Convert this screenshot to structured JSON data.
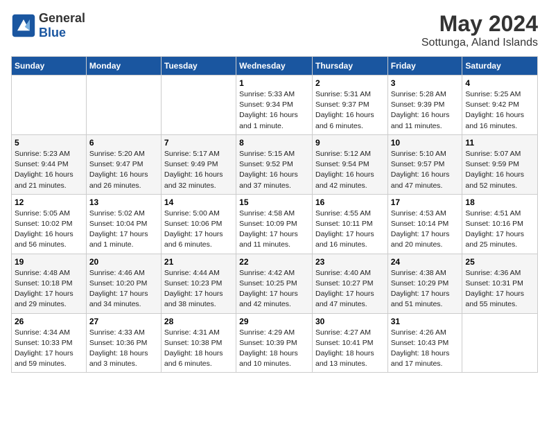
{
  "header": {
    "logo_general": "General",
    "logo_blue": "Blue",
    "month_year": "May 2024",
    "location": "Sottunga, Aland Islands"
  },
  "weekdays": [
    "Sunday",
    "Monday",
    "Tuesday",
    "Wednesday",
    "Thursday",
    "Friday",
    "Saturday"
  ],
  "weeks": [
    [
      {
        "day": "",
        "info": ""
      },
      {
        "day": "",
        "info": ""
      },
      {
        "day": "",
        "info": ""
      },
      {
        "day": "1",
        "info": "Sunrise: 5:33 AM\nSunset: 9:34 PM\nDaylight: 16 hours and 1 minute."
      },
      {
        "day": "2",
        "info": "Sunrise: 5:31 AM\nSunset: 9:37 PM\nDaylight: 16 hours and 6 minutes."
      },
      {
        "day": "3",
        "info": "Sunrise: 5:28 AM\nSunset: 9:39 PM\nDaylight: 16 hours and 11 minutes."
      },
      {
        "day": "4",
        "info": "Sunrise: 5:25 AM\nSunset: 9:42 PM\nDaylight: 16 hours and 16 minutes."
      }
    ],
    [
      {
        "day": "5",
        "info": "Sunrise: 5:23 AM\nSunset: 9:44 PM\nDaylight: 16 hours and 21 minutes."
      },
      {
        "day": "6",
        "info": "Sunrise: 5:20 AM\nSunset: 9:47 PM\nDaylight: 16 hours and 26 minutes."
      },
      {
        "day": "7",
        "info": "Sunrise: 5:17 AM\nSunset: 9:49 PM\nDaylight: 16 hours and 32 minutes."
      },
      {
        "day": "8",
        "info": "Sunrise: 5:15 AM\nSunset: 9:52 PM\nDaylight: 16 hours and 37 minutes."
      },
      {
        "day": "9",
        "info": "Sunrise: 5:12 AM\nSunset: 9:54 PM\nDaylight: 16 hours and 42 minutes."
      },
      {
        "day": "10",
        "info": "Sunrise: 5:10 AM\nSunset: 9:57 PM\nDaylight: 16 hours and 47 minutes."
      },
      {
        "day": "11",
        "info": "Sunrise: 5:07 AM\nSunset: 9:59 PM\nDaylight: 16 hours and 52 minutes."
      }
    ],
    [
      {
        "day": "12",
        "info": "Sunrise: 5:05 AM\nSunset: 10:02 PM\nDaylight: 16 hours and 56 minutes."
      },
      {
        "day": "13",
        "info": "Sunrise: 5:02 AM\nSunset: 10:04 PM\nDaylight: 17 hours and 1 minute."
      },
      {
        "day": "14",
        "info": "Sunrise: 5:00 AM\nSunset: 10:06 PM\nDaylight: 17 hours and 6 minutes."
      },
      {
        "day": "15",
        "info": "Sunrise: 4:58 AM\nSunset: 10:09 PM\nDaylight: 17 hours and 11 minutes."
      },
      {
        "day": "16",
        "info": "Sunrise: 4:55 AM\nSunset: 10:11 PM\nDaylight: 17 hours and 16 minutes."
      },
      {
        "day": "17",
        "info": "Sunrise: 4:53 AM\nSunset: 10:14 PM\nDaylight: 17 hours and 20 minutes."
      },
      {
        "day": "18",
        "info": "Sunrise: 4:51 AM\nSunset: 10:16 PM\nDaylight: 17 hours and 25 minutes."
      }
    ],
    [
      {
        "day": "19",
        "info": "Sunrise: 4:48 AM\nSunset: 10:18 PM\nDaylight: 17 hours and 29 minutes."
      },
      {
        "day": "20",
        "info": "Sunrise: 4:46 AM\nSunset: 10:20 PM\nDaylight: 17 hours and 34 minutes."
      },
      {
        "day": "21",
        "info": "Sunrise: 4:44 AM\nSunset: 10:23 PM\nDaylight: 17 hours and 38 minutes."
      },
      {
        "day": "22",
        "info": "Sunrise: 4:42 AM\nSunset: 10:25 PM\nDaylight: 17 hours and 42 minutes."
      },
      {
        "day": "23",
        "info": "Sunrise: 4:40 AM\nSunset: 10:27 PM\nDaylight: 17 hours and 47 minutes."
      },
      {
        "day": "24",
        "info": "Sunrise: 4:38 AM\nSunset: 10:29 PM\nDaylight: 17 hours and 51 minutes."
      },
      {
        "day": "25",
        "info": "Sunrise: 4:36 AM\nSunset: 10:31 PM\nDaylight: 17 hours and 55 minutes."
      }
    ],
    [
      {
        "day": "26",
        "info": "Sunrise: 4:34 AM\nSunset: 10:33 PM\nDaylight: 17 hours and 59 minutes."
      },
      {
        "day": "27",
        "info": "Sunrise: 4:33 AM\nSunset: 10:36 PM\nDaylight: 18 hours and 3 minutes."
      },
      {
        "day": "28",
        "info": "Sunrise: 4:31 AM\nSunset: 10:38 PM\nDaylight: 18 hours and 6 minutes."
      },
      {
        "day": "29",
        "info": "Sunrise: 4:29 AM\nSunset: 10:39 PM\nDaylight: 18 hours and 10 minutes."
      },
      {
        "day": "30",
        "info": "Sunrise: 4:27 AM\nSunset: 10:41 PM\nDaylight: 18 hours and 13 minutes."
      },
      {
        "day": "31",
        "info": "Sunrise: 4:26 AM\nSunset: 10:43 PM\nDaylight: 18 hours and 17 minutes."
      },
      {
        "day": "",
        "info": ""
      }
    ]
  ]
}
